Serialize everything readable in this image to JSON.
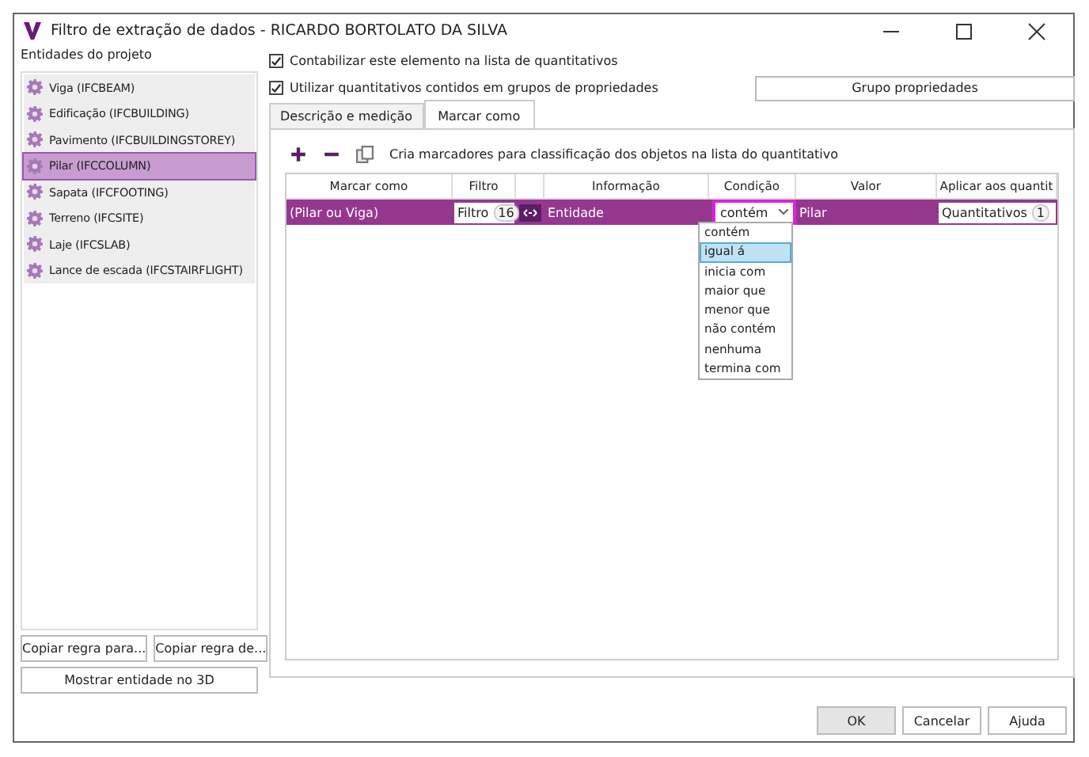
{
  "window": {
    "title": "Filtro de extração de dados - RICARDO BORTOLATO DA SILVA"
  },
  "entities": {
    "label": "Entidades do projeto",
    "items": [
      {
        "label": "Viga (IFCBEAM)",
        "selected": false
      },
      {
        "label": "Edificação (IFCBUILDING)",
        "selected": false
      },
      {
        "label": "Pavimento (IFCBUILDINGSTOREY)",
        "selected": false
      },
      {
        "label": "Pilar (IFCCOLUMN)",
        "selected": true
      },
      {
        "label": "Sapata (IFCFOOTING)",
        "selected": false
      },
      {
        "label": "Terreno (IFCSITE)",
        "selected": false
      },
      {
        "label": "Laje (IFCSLAB)",
        "selected": false
      },
      {
        "label": "Lance de escada (IFCSTAIRFLIGHT)",
        "selected": false
      }
    ]
  },
  "left_buttons": [
    "Copiar regra para...",
    "Copiar regra de..."
  ],
  "show_3d_button": "Mostrar entidade no 3D",
  "options": [
    {
      "label": "Contabilizar este elemento na lista de quantitativos",
      "checked": true
    },
    {
      "label": "Utilizar quantitativos contidos em grupos de propriedades",
      "checked": true
    }
  ],
  "group_button": "Grupo propriedades",
  "tabs": [
    {
      "label": "Descrição e medição",
      "selected": false
    },
    {
      "label": "Marcar como",
      "selected": true
    }
  ],
  "toolbar": {
    "hint": "Cria marcadores para classificação dos objetos na lista do quantitativo"
  },
  "table": {
    "columns": [
      "Marcar como",
      "Filtro",
      "Informação",
      "Condição",
      "Valor",
      "Aplicar aos quantit"
    ],
    "rows": [
      {
        "mark": "(Pilar ou Viga)",
        "filter": "Filtro",
        "filter_count": "16",
        "info": "Entidade",
        "condition": "contém",
        "value": "Pilar",
        "apply": "Quantitativos",
        "apply_count": "1",
        "selected": true
      }
    ]
  },
  "dropdown": {
    "options": [
      {
        "label": "contém",
        "selected": false
      },
      {
        "label": "igual á",
        "selected": true
      },
      {
        "label": "inicia com",
        "selected": false
      },
      {
        "label": "maior que",
        "selected": false
      },
      {
        "label": "menor que",
        "selected": false
      },
      {
        "label": "não contém",
        "selected": false
      },
      {
        "label": "nenhuma",
        "selected": false
      },
      {
        "label": "termina com",
        "selected": false
      }
    ]
  },
  "footer_buttons": [
    "OK",
    "Cancelar",
    "Ajuda"
  ]
}
